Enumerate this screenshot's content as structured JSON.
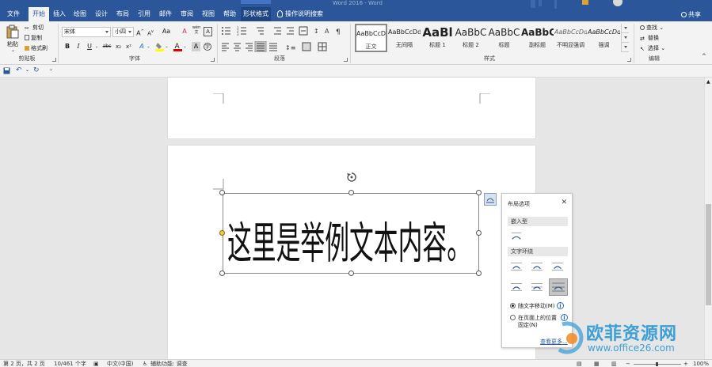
{
  "window": {
    "title_fragment": "Word 2016 - Word"
  },
  "tabs": [
    {
      "label": "文件",
      "active": false
    },
    {
      "label": "开始",
      "active": true
    },
    {
      "label": "插入",
      "active": false
    },
    {
      "label": "绘图",
      "active": false
    },
    {
      "label": "设计",
      "active": false
    },
    {
      "label": "布局",
      "active": false
    },
    {
      "label": "引用",
      "active": false
    },
    {
      "label": "邮件",
      "active": false
    },
    {
      "label": "审阅",
      "active": false
    },
    {
      "label": "视图",
      "active": false
    },
    {
      "label": "帮助",
      "active": false
    },
    {
      "label": "形状格式",
      "active": false,
      "contextual": true
    }
  ],
  "tell_me": "操作说明搜索",
  "share_label": "共享",
  "clipboard": {
    "paste_label": "粘贴",
    "cut_label": "剪切",
    "copy_label": "复制",
    "format_painter_label": "格式刷",
    "group_label": "剪贴板"
  },
  "font": {
    "font_name": "宋体",
    "font_size": "小四",
    "group_label": "字体",
    "bold": "B",
    "italic": "I",
    "underline": "U",
    "strike": "abc",
    "subscript": "x₂",
    "superscript": "x²",
    "grow": "A",
    "shrink": "A",
    "case": "Aa",
    "clear": "A",
    "phonetic": "wén",
    "border_char": "A",
    "highlight_color": "#ffff00",
    "font_color": "#e00000"
  },
  "paragraph": {
    "group_label": "段落"
  },
  "styles": {
    "group_label": "样式",
    "items": [
      {
        "sample": "AaBbCcDd",
        "name": "正文",
        "selected": true
      },
      {
        "sample": "AaBbCcDd",
        "name": "无间隔",
        "selected": false
      },
      {
        "sample": "AaBl",
        "name": "标题 1",
        "selected": false
      },
      {
        "sample": "AaBbC",
        "name": "标题 2",
        "selected": false
      },
      {
        "sample": "AaBbC",
        "name": "标题",
        "selected": false
      },
      {
        "sample": "AaBbC",
        "name": "副标题",
        "selected": false
      },
      {
        "sample": "AaBbCcDd",
        "name": "不明显强调",
        "selected": false
      },
      {
        "sample": "AaBbCcDd",
        "name": "强调",
        "selected": false
      }
    ]
  },
  "editing": {
    "group_label": "编辑",
    "find_label": "查找",
    "replace_label": "替换",
    "select_label": "选择"
  },
  "document": {
    "wordart_text": "这里是举例文本内容。"
  },
  "layout_options": {
    "title": "布局选项",
    "inline_label": "嵌入型",
    "wrap_label": "文字环绕",
    "move_with_text": "随文字移动(M)",
    "fix_position_line1": "在页面上的位置",
    "fix_position_line2": "固定(N)",
    "see_more": "查看更多..."
  },
  "status": {
    "page": "第 2 页，共 2 页",
    "words": "10/461 个字",
    "language": "中文(中国)",
    "accessibility": "辅助功能: 调查",
    "zoom": "100%"
  },
  "watermark": {
    "title": "欧菲资源网",
    "url": "www.office26.com"
  },
  "colors": {
    "ribbon_blue": "#2b579a",
    "watermark_blue": "#3e9fd6"
  }
}
